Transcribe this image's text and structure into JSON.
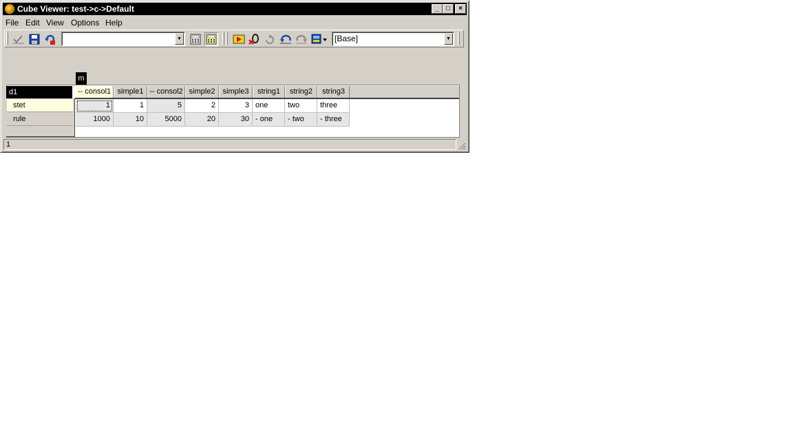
{
  "window": {
    "title": "Cube Viewer: test->c->Default",
    "controls": {
      "minimize": "_",
      "maximize": "□",
      "close": "×"
    }
  },
  "menu": [
    "File",
    "Edit",
    "View",
    "Options",
    "Help"
  ],
  "toolbar": {
    "view_combo_value": "",
    "subset_combo_value": "[Base]",
    "icons": [
      "recalc-check-icon",
      "save-icon",
      "reload-icon",
      "calculator-icon",
      "auto-calc-icon",
      "arrow-zoom-icon",
      "zero-suppress-icon",
      "refresh-icon",
      "undo-icon",
      "redo-icon",
      "export-icon"
    ]
  },
  "grid": {
    "column_dimension": "m",
    "row_dimension": "d1",
    "columns": [
      "-- consol1",
      "simple1",
      "-- consol2",
      "simple2",
      "simple3",
      "string1",
      "string2",
      "string3"
    ],
    "rows": [
      {
        "label": "stet",
        "cells": [
          "1",
          "1",
          "5",
          "2",
          "3",
          "one",
          "two",
          "three"
        ]
      },
      {
        "label": "rule",
        "cells": [
          "1000",
          "10",
          "5000",
          "20",
          "30",
          "- one",
          "- two",
          "- three"
        ]
      }
    ]
  },
  "status": {
    "text": "1"
  },
  "colors": {
    "selected_header": "#ffffe0",
    "consolidated_cell": "#e6e6e6",
    "titlebar": "#000000"
  }
}
